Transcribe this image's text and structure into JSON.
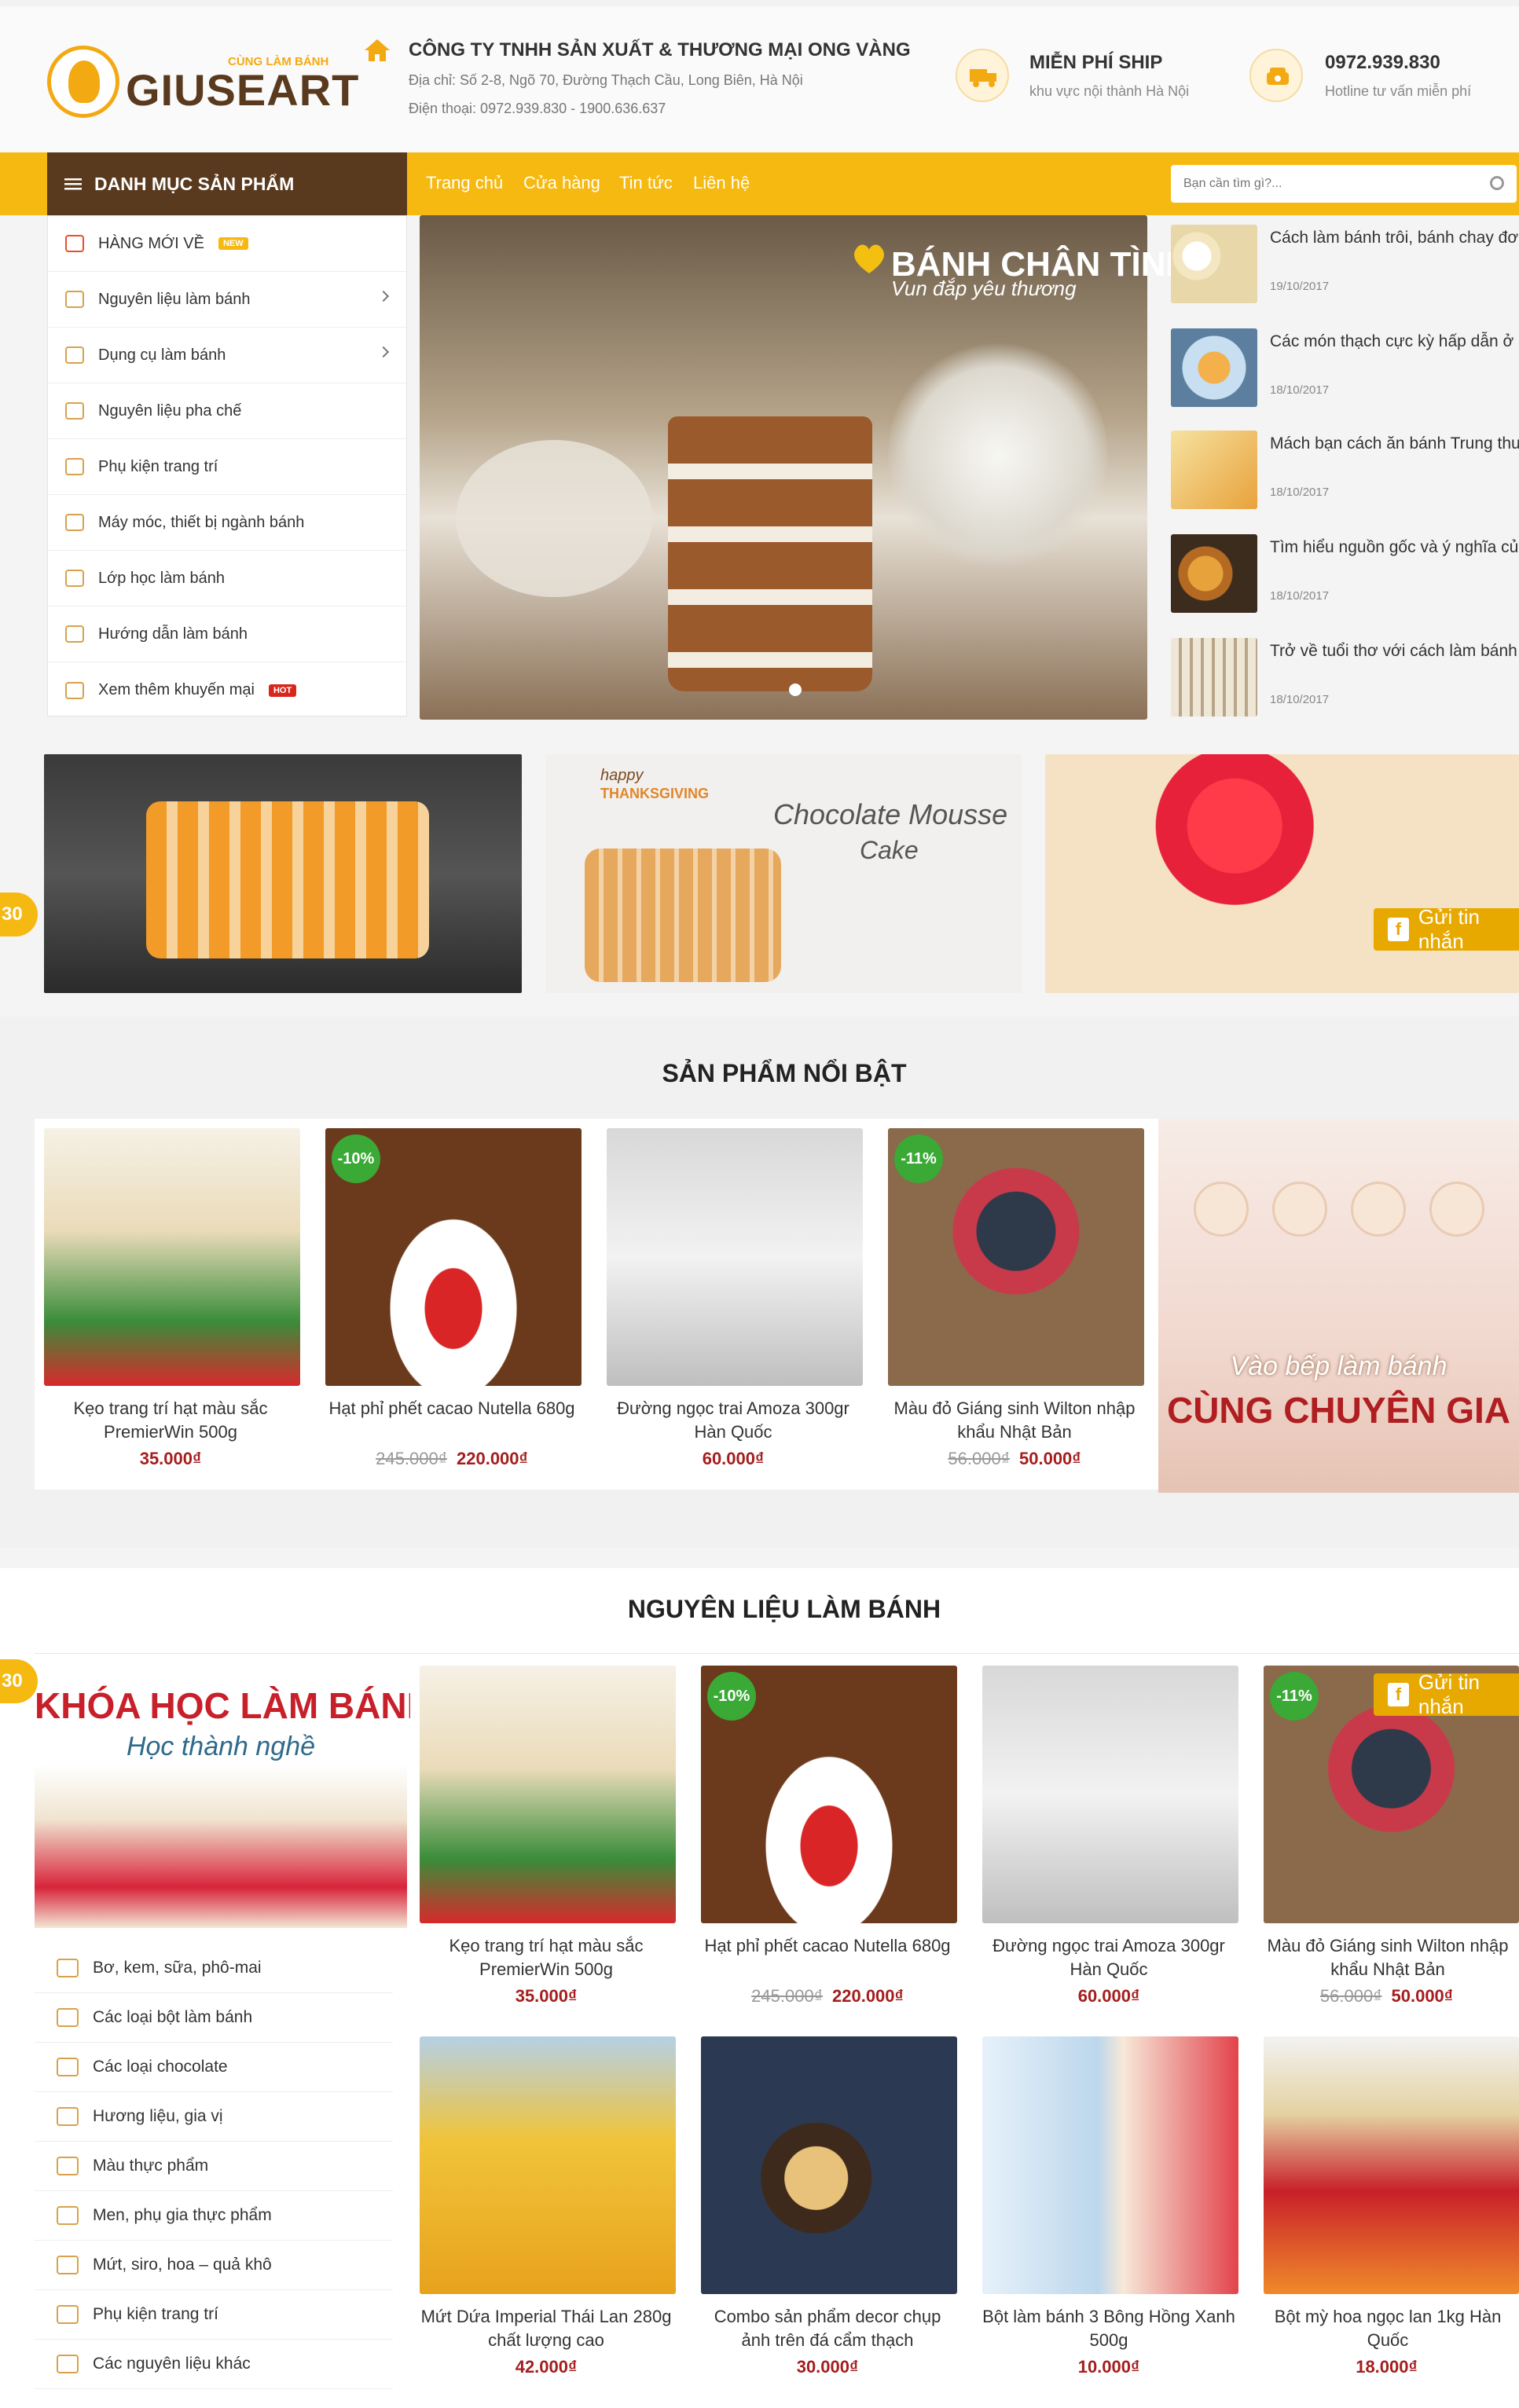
{
  "header": {
    "logo_tagline": "CÙNG LÀM BÁNH",
    "logo_name": "GIUSEART",
    "company": "CÔNG TY TNHH SẢN XUẤT & THƯƠNG MẠI ONG VÀNG",
    "address": "Địa chỉ: Số 2-8, Ngõ 70, Đường Thạch Cầu, Long Biên, Hà Nội",
    "phone": "Điện thoại: 0972.939.830 - 1900.636.637",
    "ship_title": "MIỄN PHÍ SHIP",
    "ship_sub": "khu vực nội thành Hà Nội",
    "hotline_title": "0972.939.830",
    "hotline_sub": "Hotline tư vấn miễn phí"
  },
  "nav": {
    "category_heading": "DANH MỤC SẢN PHẨM",
    "links": [
      "Trang chủ",
      "Cửa hàng",
      "Tin tức",
      "Liên hệ"
    ],
    "search_placeholder": "Bạn cần tìm gì?..."
  },
  "categories": [
    {
      "label": "HÀNG MỚI VỀ",
      "badge": "NEW"
    },
    {
      "label": "Nguyên liệu làm bánh"
    },
    {
      "label": "Dụng cụ làm bánh"
    },
    {
      "label": "Nguyên liệu pha chế"
    },
    {
      "label": "Phụ kiện trang trí"
    },
    {
      "label": "Máy móc, thiết bị ngành bánh"
    },
    {
      "label": "Lớp học làm bánh"
    },
    {
      "label": "Hướng dẫn làm bánh"
    },
    {
      "label": "Xem thêm khuyến mại",
      "badge": "HOT"
    }
  ],
  "slider": {
    "title": "BÁNH CHÂN TÌNH",
    "subtitle": "Vun đắp yêu thương"
  },
  "news": [
    {
      "title": "Cách làm bánh trôi, bánh chay đơn giản nhất",
      "date": "19/10/2017"
    },
    {
      "title": "Các món thạch cực kỳ hấp dẫn ở Hà Nội trong ngày hè",
      "date": "18/10/2017"
    },
    {
      "title": "Mách bạn cách ăn bánh Trung thu mà vẫn giữ được vóc dáng",
      "date": "18/10/2017"
    },
    {
      "title": "Tìm hiểu nguồn gốc và ý nghĩa của bánh Trung thu",
      "date": "18/10/2017"
    },
    {
      "title": "Trở về tuổi thơ với cách làm bánh đuông thơm lừng",
      "date": "18/10/2017"
    }
  ],
  "banners": {
    "mousse_line1": "Chocolate Mousse",
    "mousse_line2": "Cake",
    "thanks_line1": "happy",
    "thanks_line2": "THANKSGIVING"
  },
  "featured": {
    "title": "SẢN PHẨM NỔI BẬT",
    "products": [
      {
        "name": "Kẹo trang trí hạt màu sắc PremierWin 500g",
        "price": "35.000₫",
        "old_price": "",
        "discount": ""
      },
      {
        "name": "Hạt phỉ phết cacao Nutella 680g",
        "price": "220.000₫",
        "old_price": "245.000₫",
        "discount": "-10%"
      },
      {
        "name": "Đường ngọc trai Amoza 300gr Hàn Quốc",
        "price": "60.000₫",
        "old_price": "",
        "discount": ""
      },
      {
        "name": "Màu đỏ Giáng sinh Wilton nhập khẩu Nhật Bản",
        "price": "50.000₫",
        "old_price": "56.000₫",
        "discount": "-11%"
      }
    ],
    "promo_line1": "Vào bếp làm bánh",
    "promo_line2": "CÙNG CHUYÊN GIA"
  },
  "ingredients": {
    "title": "NGUYÊN LIỆU LÀM BÁNH",
    "banner_line1": "KHÓA HỌC LÀM BÁNH",
    "banner_line2": "Học thành nghề",
    "side_categories": [
      "Bơ, kem, sữa, phô-mai",
      "Các loại bột làm bánh",
      "Các loại chocolate",
      "Hương liệu, gia vị",
      "Màu thực phẩm",
      "Men, phụ gia thực phẩm",
      "Mứt, siro, hoa – quả khô",
      "Phụ kiện trang trí",
      "Các nguyên liệu khác"
    ],
    "products": [
      {
        "name": "Kẹo trang trí hạt màu sắc PremierWin 500g",
        "price": "35.000₫",
        "old_price": "",
        "discount": ""
      },
      {
        "name": "Hạt phỉ phết cacao Nutella 680g",
        "price": "220.000₫",
        "old_price": "245.000₫",
        "discount": "-10%"
      },
      {
        "name": "Đường ngọc trai Amoza 300gr Hàn Quốc",
        "price": "60.000₫",
        "old_price": "",
        "discount": ""
      },
      {
        "name": "Màu đỏ Giáng sinh Wilton nhập khẩu Nhật Bản",
        "price": "50.000₫",
        "old_price": "56.000₫",
        "discount": "-11%"
      },
      {
        "name": "Mứt Dứa Imperial Thái Lan 280g chất lượng cao",
        "price": "42.000₫",
        "old_price": "",
        "discount": ""
      },
      {
        "name": "Combo sản phẩm decor chụp ảnh trên đá cẩm thạch",
        "price": "30.000₫",
        "old_price": "",
        "discount": ""
      },
      {
        "name": "Bột làm bánh 3 Bông Hồng Xanh 500g",
        "price": "10.000₫",
        "old_price": "",
        "discount": ""
      },
      {
        "name": "Bột mỳ hoa ngọc lan 1kg Hàn Quốc",
        "price": "18.000₫",
        "old_price": "",
        "discount": ""
      }
    ]
  },
  "floating": {
    "fb_label": "Gửi tin nhắn",
    "side_number": "30"
  },
  "colors": {
    "brand_yellow": "#f6b912",
    "brand_brown": "#5a3a1e",
    "price_red": "#a51d1d",
    "discount_green": "#3aa935"
  }
}
